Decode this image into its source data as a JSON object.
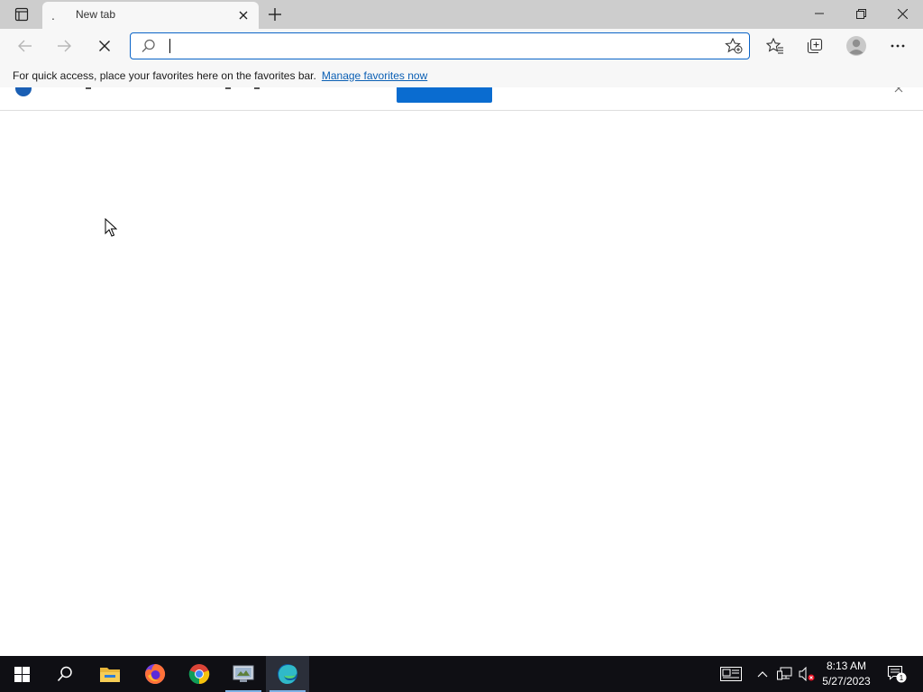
{
  "browser": {
    "tab": {
      "title": "New tab",
      "favicon": "."
    },
    "address": {
      "value": "",
      "placeholder": ""
    },
    "favorites_bar": {
      "message": "For quick access, place your favorites here on the favorites bar.",
      "link": "Manage favorites now"
    }
  },
  "icons": {
    "tab_actions": "tab-actions-icon",
    "close_tab": "close-icon",
    "new_tab": "plus-icon",
    "minimize": "minimize-icon",
    "restore": "restore-icon",
    "close_window": "close-icon",
    "back": "back-arrow-icon",
    "forward": "forward-arrow-icon",
    "stop": "stop-icon",
    "search": "search-icon",
    "add_favorite": "star-add-icon",
    "favorites": "favorites-icon",
    "collections": "collections-icon",
    "profile": "profile-icon",
    "more": "more-icon"
  },
  "taskbar": {
    "apps": [
      "start-icon",
      "search-icon",
      "file-explorer-icon",
      "firefox-icon",
      "chrome-icon",
      "control-panel-icon",
      "edge-icon"
    ],
    "active_app": "edge-icon",
    "time": "8:13 AM",
    "date": "5/27/2023",
    "notification_count": "1"
  },
  "colors": {
    "accent": "#0a64c8",
    "link": "#0a5fb4",
    "titlebar": "#cdcdcd",
    "toolbar": "#f7f7f7",
    "taskbar": "#0f0f14"
  }
}
